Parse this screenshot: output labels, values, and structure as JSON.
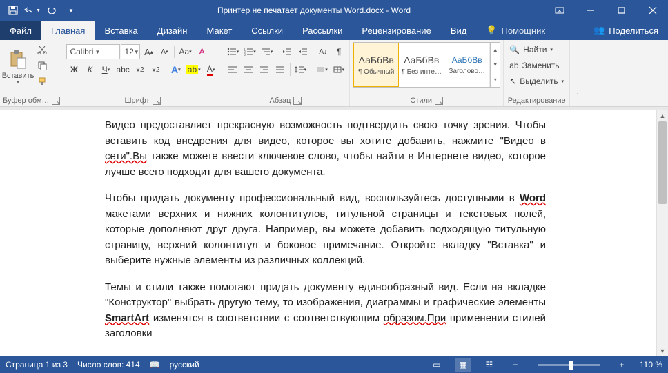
{
  "title": "Принтер не печатает документы Word.docx  -  Word",
  "tabs": {
    "file": "Файл",
    "home": "Главная",
    "insert": "Вставка",
    "design": "Дизайн",
    "layout": "Макет",
    "references": "Ссылки",
    "mailings": "Рассылки",
    "review": "Рецензирование",
    "view": "Вид",
    "tell": "Помощник",
    "share": "Поделиться"
  },
  "groups": {
    "clipboard": {
      "label": "Буфер обм…",
      "paste": "Вставить"
    },
    "font": {
      "label": "Шрифт",
      "name": "Calibri",
      "size": "12"
    },
    "paragraph": {
      "label": "Абзац"
    },
    "styles": {
      "label": "Стили",
      "preview": "АаБбВв",
      "items": [
        "¶ Обычный",
        "¶ Без инте…",
        "Заголово…"
      ]
    },
    "editing": {
      "label": "Редактирование",
      "find": "Найти",
      "replace": "Заменить",
      "select": "Выделить"
    }
  },
  "document": {
    "p1": "Видео предоставляет прекрасную возможность подтвердить свою точку зрения. Чтобы вставить код внедрения для видео, которое вы хотите добавить, нажмите \"Видео в ",
    "p1b": "сети\".Вы",
    "p1c": " также можете ввести ключевое слово, чтобы найти в Интернете видео, которое лучше всего подходит для вашего документа.",
    "p2a": "Чтобы придать документу профессиональный вид, воспользуйтесь доступными в ",
    "p2b": "Word",
    "p2c": " макетами верхних и нижних колонтитулов, титульной страницы и текстовых полей, которые дополняют друг друга. Например, вы можете добавить подходящую титульную страницу, верхний колонтитул и боковое примечание. Откройте вкладку \"Вставка\" и выберите нужные элементы из различных коллекций.",
    "p3a": "Темы и стили также помогают придать документу единообразный вид. Если на вкладке \"Конструктор\" выбрать другую тему, то изображения, диаграммы и графические элементы ",
    "p3b": "SmartArt",
    "p3c": " изменятся в соответствии с соответствующим ",
    "p3d": "образом.При",
    "p3e": " применении стилей заголовки"
  },
  "statusbar": {
    "page": "Страница 1 из 3",
    "words": "Число слов: 414",
    "language": "русский",
    "zoom": "110 %"
  }
}
